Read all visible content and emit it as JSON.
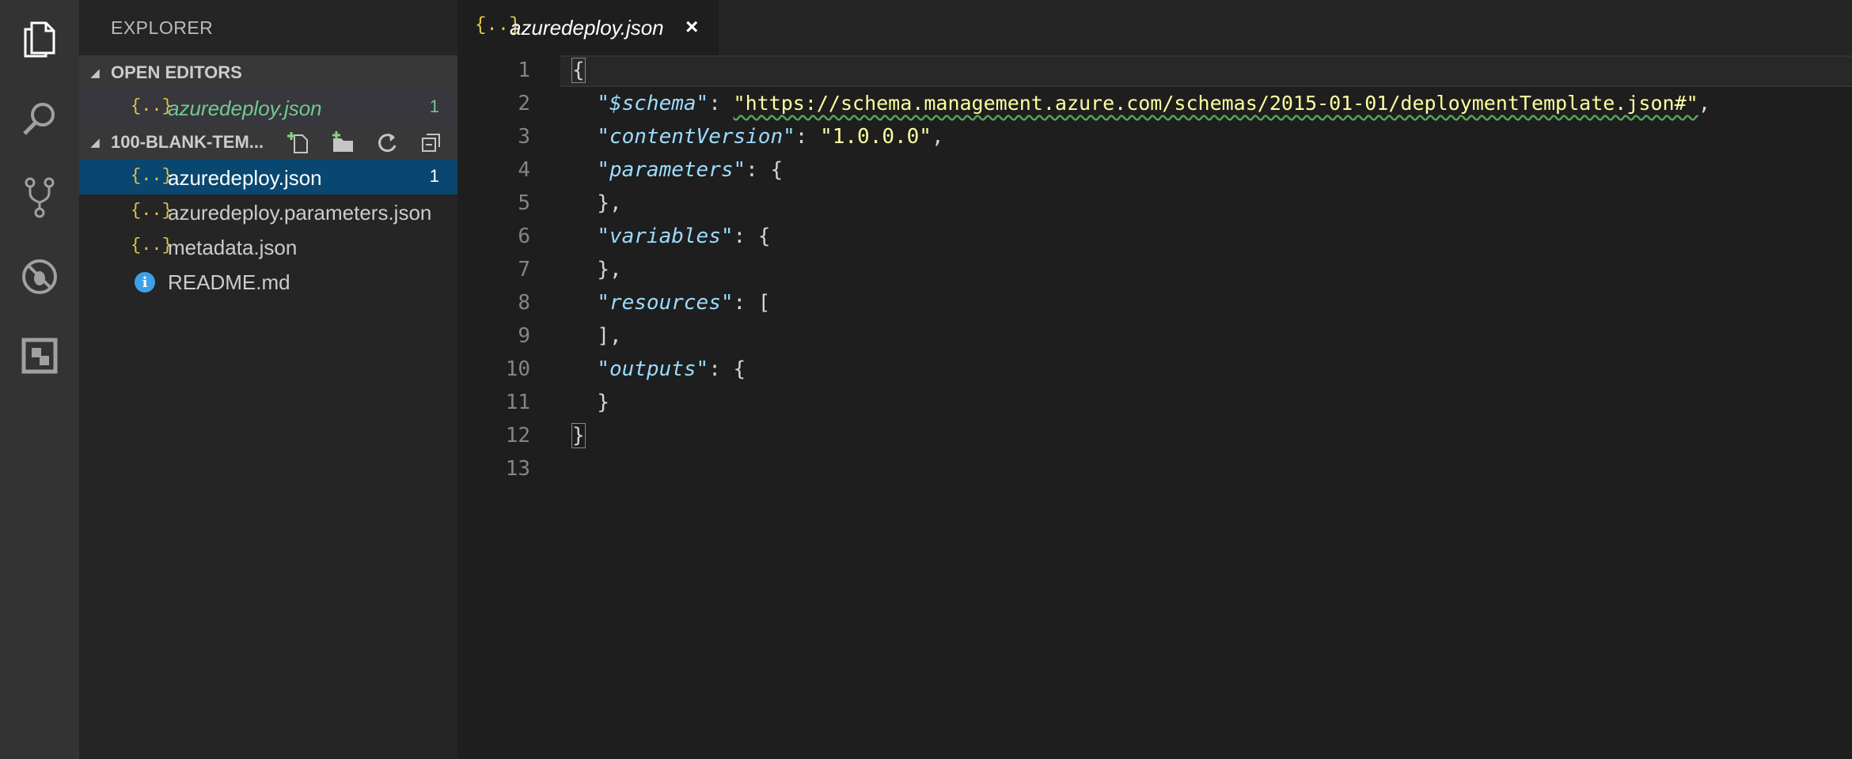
{
  "activity_bar": {
    "icons": [
      "files-icon",
      "search-icon",
      "source-control-icon",
      "debug-icon",
      "extensions-icon"
    ]
  },
  "sidebar": {
    "title": "EXPLORER",
    "open_editors": {
      "label": "OPEN EDITORS",
      "items": [
        {
          "icon": "{..}",
          "name": "azuredeploy.json",
          "badge": "1"
        }
      ]
    },
    "folder": {
      "label": "100-BLANK-TEM...",
      "items": [
        {
          "icon": "{..}",
          "name": "azuredeploy.json",
          "badge": "1"
        },
        {
          "icon": "{..}",
          "name": "azuredeploy.parameters.json",
          "badge": ""
        },
        {
          "icon": "{..}",
          "name": "metadata.json",
          "badge": ""
        },
        {
          "icon": "i",
          "name": "README.md",
          "badge": ""
        }
      ]
    }
  },
  "tab": {
    "icon": "{..}",
    "name": "azuredeploy.json",
    "close": "×"
  },
  "editor": {
    "line_numbers": [
      "1",
      "2",
      "3",
      "4",
      "5",
      "6",
      "7",
      "8",
      "9",
      "10",
      "11",
      "12",
      "13"
    ],
    "lines": {
      "l1": "{",
      "l2_key": "\"$schema\"",
      "l2_sep": ": ",
      "l2_val": "\"https://schema.management.azure.com/schemas/2015-01-01/deploymentTemplate.json#\"",
      "l2_end": ",",
      "l3_key": "\"contentVersion\"",
      "l3_sep": ": ",
      "l3_val": "\"1.0.0.0\"",
      "l3_end": ",",
      "l4_key": "\"parameters\"",
      "l4_end": ": {",
      "l5": "},",
      "l6_key": "\"variables\"",
      "l6_end": ": {",
      "l7": "},",
      "l8_key": "\"resources\"",
      "l8_end": ": [",
      "l9": "],",
      "l10_key": "\"outputs\"",
      "l10_end": ": {",
      "l11": "}",
      "l12": "}"
    }
  },
  "colors": {
    "activity_bg": "#333333",
    "sidebar_bg": "#252526",
    "selected_bg": "#094771",
    "editor_bg": "#1e1e1e",
    "modified_green": "#73c991"
  }
}
